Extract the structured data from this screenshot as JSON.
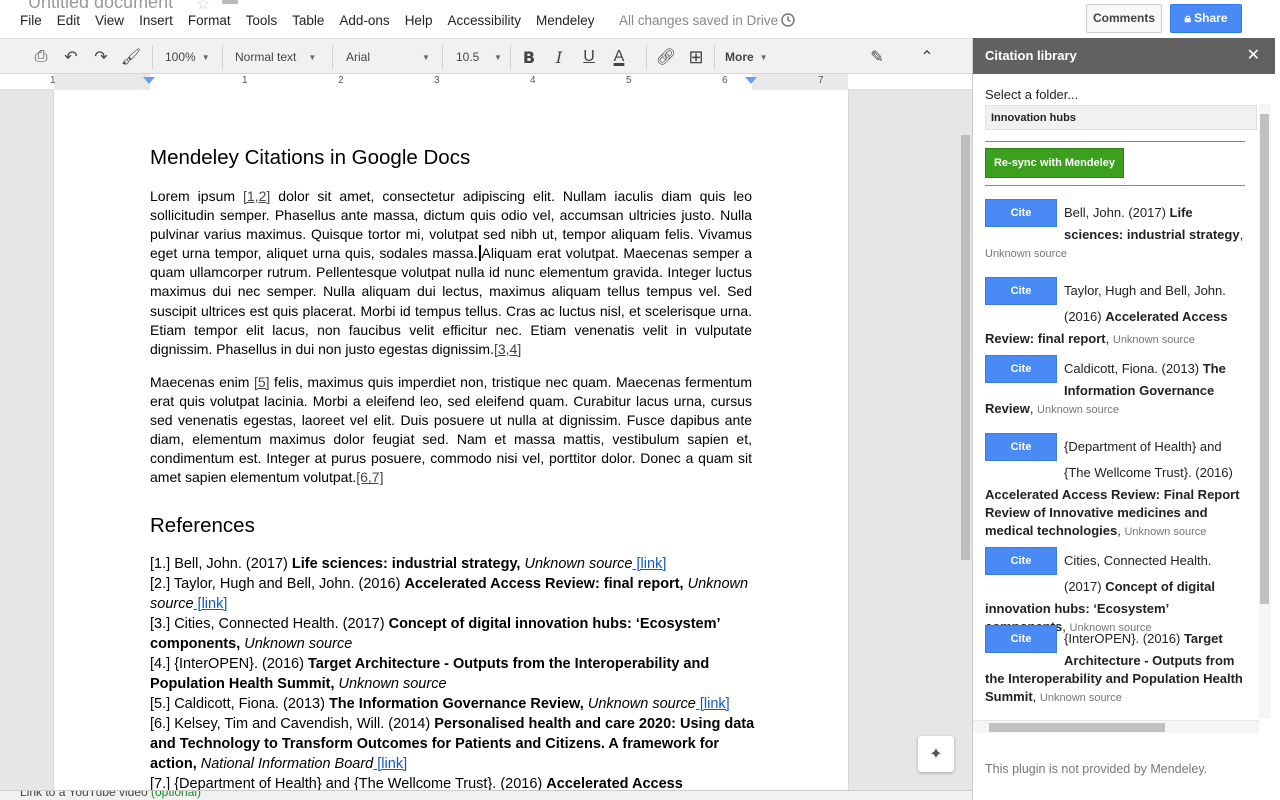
{
  "app": {
    "doc_title": "Untitled document",
    "menu": [
      "File",
      "Edit",
      "View",
      "Insert",
      "Format",
      "Tools",
      "Table",
      "Add-ons",
      "Help",
      "Accessibility",
      "Mendeley"
    ],
    "saved_status": "All changes saved in Drive",
    "comments_label": "Comments",
    "share_label": "Share"
  },
  "toolbar": {
    "zoom": "100%",
    "style": "Normal text",
    "font": "Arial",
    "size": "10.5",
    "more": "More"
  },
  "ruler": {
    "numbers": [
      "1",
      "1",
      "2",
      "3",
      "4",
      "5",
      "6",
      "7"
    ]
  },
  "document": {
    "title": "Mendeley Citations in Google Docs",
    "p1": {
      "a": "Lorem ipsum ",
      "c1": "[1,2]",
      "b": " dolor sit amet, consectetur adipiscing elit. Nullam iaculis diam quis leo sollicitudin semper. Phasellus ante massa, dictum quis odio vel, accumsan ultricies justo. Nulla pulvinar varius maximus. Quisque tortor mi, volutpat sed nibh ut, tempor aliquam felis. Vivamus eget urna tempor, aliquet urna quis, sodales massa.",
      "c": "Aliquam erat volutpat. Maecenas semper a quam ullamcorper rutrum. Pellentesque volutpat nulla id nunc elementum gravida. Integer luctus maximus dui nec semper. Nulla aliquam dui lectus, maximus aliquam tellus tempus vel. Sed suscipit ultrices est quis placerat. Morbi id tempus tellus. Cras ac luctus nisl, et scelerisque urna. Etiam tempor elit lacus, non faucibus velit efficitur nec. Etiam venenatis velit in vulputate dignissim. Phasellus in dui non justo egestas dignissim.",
      "c2": "[3,4]"
    },
    "p2": {
      "a": "Maecenas enim ",
      "c1": "[5]",
      "b": " felis, maximus quis imperdiet non, tristique nec quam. Maecenas fermentum erat quis volutpat lacinia. Morbi a eleifend leo, sed eleifend quam. Curabitur lacus urna, cursus sed venenatis egestas, laoreet vel elit. Duis posuere ut nulla at dignissim. Fusce dapibus ante diam, elementum maximus dolor feugiat sed. Nam et massa mattis, vestibulum sapien et, condimentum est. Integer at purus posuere, commodo nisi vel, porttitor dolor. Donec a quam sit amet sapien elementum volutpat.",
      "c2": "[6,7]"
    },
    "refs_title": "References",
    "refs": [
      {
        "n": "[1.] ",
        "author": "Bell, John. (2017) ",
        "title": "Life sciences: industrial strategy,",
        "src": " Unknown source",
        "link": " [link]"
      },
      {
        "n": "[2.] ",
        "author": "Taylor, Hugh and Bell, John. (2016) ",
        "title": "Accelerated Access Review: final report,",
        "src": " Unknown source",
        "link": " [link]"
      },
      {
        "n": "[3.] ",
        "author": "Cities, Connected Health. (2017) ",
        "title": "Concept of digital innovation hubs: ‘Ecosystem’ components,",
        "src": " Unknown source",
        "link": ""
      },
      {
        "n": "[4.] ",
        "author": "{InterOPEN}. (2016) ",
        "title": "Target Architecture - Outputs from the Interoperability and Population Health Summit,",
        "src": " Unknown source",
        "link": ""
      },
      {
        "n": "[5.] ",
        "author": "Caldicott, Fiona. (2013) ",
        "title": "The Information Governance Review,",
        "src": " Unknown source",
        "link": " [link]"
      },
      {
        "n": "[6.] ",
        "author": "Kelsey, Tim and Cavendish, Will. (2014) ",
        "title": "Personalised health and care 2020: Using data and Technology to Transform Outcomes for Patients and Citizens. A framework for action,",
        "src": " National Information Board",
        "link": " [link]"
      },
      {
        "n": "[7.] ",
        "author": "{Department of Health} and {The Wellcome Trust}. (2016) ",
        "title": "Accelerated Access",
        "src": "",
        "link": ""
      }
    ],
    "bottom_tab": "Link to a YouTube video",
    "bottom_tab_opt": "(optional)"
  },
  "panel": {
    "title": "Citation library",
    "select_label": "Select a folder...",
    "selected_folder": "Innovation hubs",
    "resync_label": "Re-sync with Mendeley",
    "cite_label": "Cite",
    "entries": [
      {
        "author": "Bell, John. (2017) ",
        "title": "Life sciences: industrial strategy",
        "src": "Unknown source"
      },
      {
        "author": "Taylor, Hugh and Bell, John. (2016) ",
        "title": "Accelerated Access Review: final report",
        "src": "Unknown source"
      },
      {
        "author": "Caldicott, Fiona. (2013) ",
        "title": "The Information Governance Review",
        "src": "Unknown source"
      },
      {
        "author": "{Department of Health} and {The Wellcome Trust}. (2016) ",
        "title": "Accelerated Access Review: Final Report Review of Innovative medicines and medical technologies",
        "src": "Unknown source"
      },
      {
        "author": "Cities, Connected Health. (2017) ",
        "title": "Concept of digital innovation hubs: ‘Ecosystem’ components",
        "src": "Unknown source"
      },
      {
        "author": "{InterOPEN}. (2016) ",
        "title": "Target Architecture - Outputs from the Interoperability and Population Health Summit",
        "src": "Unknown source"
      }
    ],
    "footer": "This plugin is not provided by Mendeley."
  }
}
